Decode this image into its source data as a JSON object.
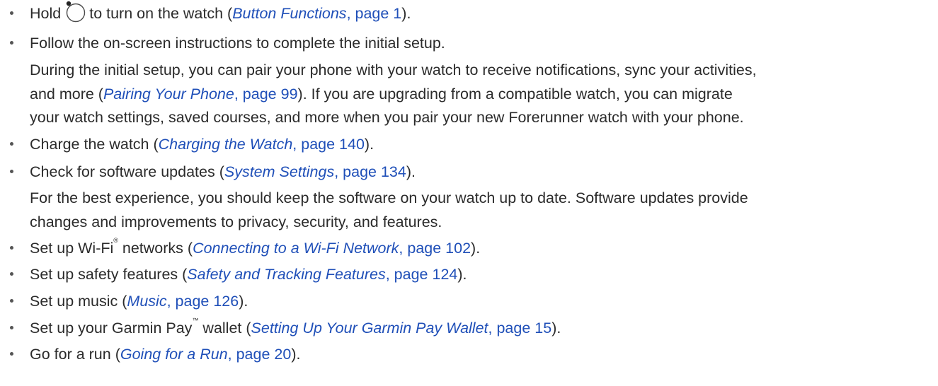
{
  "items": [
    {
      "pre": "Hold",
      "mid": "to turn on the watch (",
      "link_title": "Button Functions",
      "link_page": ", page 1",
      "post": ")."
    },
    {
      "text": "Follow the on-screen instructions to complete the initial setup."
    },
    {
      "para_line1": "During the initial setup, you can pair your phone with your watch to receive notifications, sync your activities,",
      "para_line2_pre": "and more (",
      "para_line2_link_title": "Pairing Your Phone",
      "para_line2_link_page": ", page 99",
      "para_line2_post": "). If you are upgrading from a compatible watch, you can migrate",
      "para_line3": "your watch settings, saved courses, and more when you pair your new Forerunner watch with your phone."
    },
    {
      "pre": "Charge the watch (",
      "link_title": "Charging the Watch",
      "link_page": ", page 140",
      "post": ")."
    },
    {
      "pre": "Check for software updates (",
      "link_title": "System Settings",
      "link_page": ", page 134",
      "post": ")."
    },
    {
      "para_line1": "For the best experience, you should keep the software on your watch up to date. Software updates provide",
      "para_line2": "changes and improvements to privacy, security, and features."
    },
    {
      "pre": "Set up Wi-Fi",
      "mark": "®",
      "mid": " networks (",
      "link_title": "Connecting to a Wi-Fi Network",
      "link_page": ", page 102",
      "post": ")."
    },
    {
      "pre": "Set up safety features (",
      "link_title": "Safety and Tracking Features",
      "link_page": ", page 124",
      "post": ")."
    },
    {
      "pre": "Set up music (",
      "link_title": "Music",
      "link_page": ", page 126",
      "post": ")."
    },
    {
      "pre": "Set up your Garmin Pay",
      "mark": "™",
      "mid": " wallet (",
      "link_title": "Setting Up Your Garmin Pay Wallet",
      "link_page": ", page 15",
      "post": ")."
    },
    {
      "pre": "Go for a run (",
      "link_title": "Going for a Run",
      "link_page": ", page 20",
      "post": ")."
    }
  ],
  "icons": {
    "power_button": "watch-button-icon"
  },
  "colors": {
    "text": "#2b2b2b",
    "link": "#1f4fb8"
  }
}
